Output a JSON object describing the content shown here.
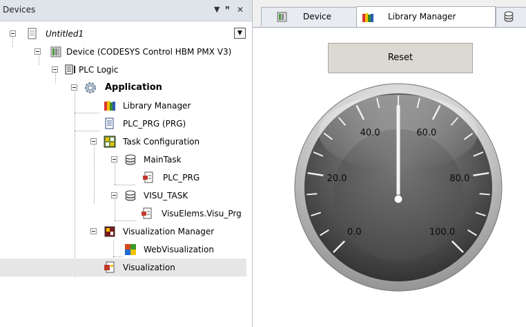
{
  "devices_panel": {
    "title": "Devices",
    "pin_glyph": "▾",
    "pushpin_glyph": "ᵖ",
    "close_glyph": "✕",
    "tree": [
      {
        "label": "Untitled1",
        "icon": "project-icon"
      },
      {
        "label": "Device (CODESYS Control HBM PMX V3)",
        "icon": "device-icon"
      },
      {
        "label": "PLC Logic",
        "icon": "plc-logic-icon"
      },
      {
        "label": "Application",
        "icon": "application-gear-icon"
      },
      {
        "label": "Library Manager",
        "icon": "library-books-icon"
      },
      {
        "label": "PLC_PRG (PRG)",
        "icon": "program-document-icon"
      },
      {
        "label": "Task Configuration",
        "icon": "task-configuration-icon"
      },
      {
        "label": "MainTask",
        "icon": "task-icon"
      },
      {
        "label": "PLC_PRG",
        "icon": "program-call-icon"
      },
      {
        "label": "VISU_TASK",
        "icon": "task-icon"
      },
      {
        "label": "VisuElems.Visu_Prg",
        "icon": "program-call-icon"
      },
      {
        "label": "Visualization Manager",
        "icon": "visualization-manager-icon"
      },
      {
        "label": "WebVisualization",
        "icon": "web-visualization-icon"
      },
      {
        "label": "Visualization",
        "icon": "visualization-icon"
      }
    ]
  },
  "editor": {
    "tabs": [
      {
        "label": "Device",
        "icon": "device-icon"
      },
      {
        "label": "Library Manager",
        "icon": "library-books-icon"
      },
      {
        "label": "",
        "icon": "task-icon"
      }
    ],
    "reset_label": "Reset",
    "gauge": {
      "min": 0,
      "max": 100,
      "value": 50,
      "labels": [
        "0.0",
        "20.0",
        "40.0",
        "60.0",
        "80.0",
        "100.0"
      ]
    }
  },
  "colors": {
    "panel_header_bg": "#dfe4ea",
    "selection_bg": "#e6e6e6",
    "button_bg": "#dcd8d2",
    "gauge_face_dark": "#3a3a3a",
    "gauge_rim": "#d8d8d8"
  }
}
